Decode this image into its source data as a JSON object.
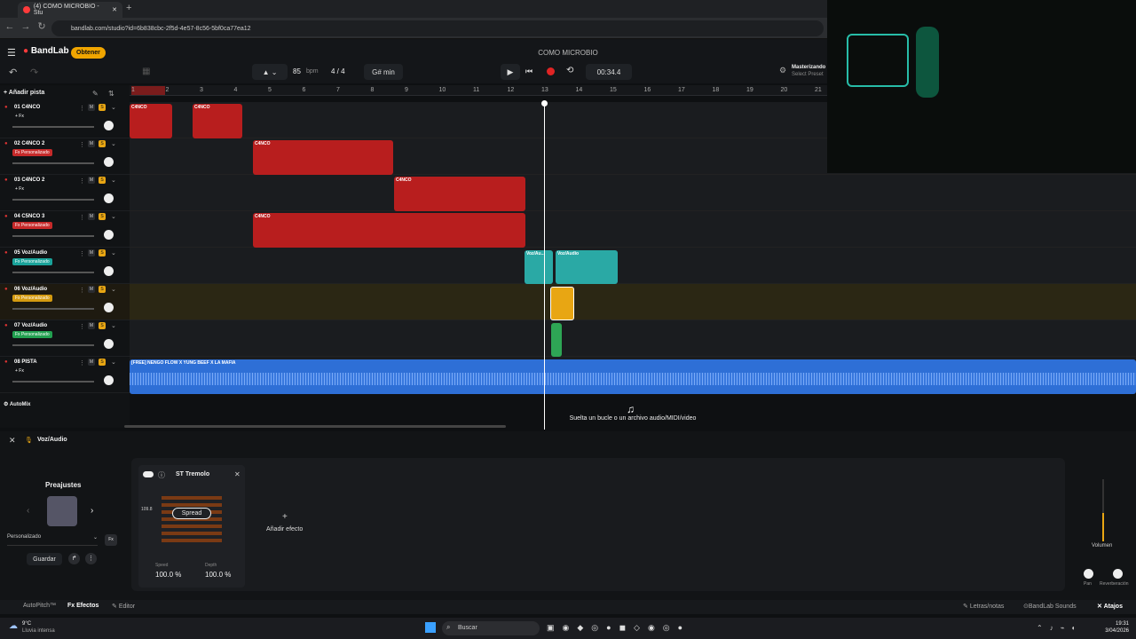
{
  "browser": {
    "tab_title": "(4) COMO MICROBIO - Stu",
    "url": "bandlab.com/studio?id=6b838cbc-2f5d-4e57-8c56-5bf0ca77ea12"
  },
  "app": {
    "logo": "BandLab",
    "get_label": "Obtener",
    "song_title": "COMO MICROBIO"
  },
  "toolbar": {
    "bpm": "85",
    "bpm_unit": "bpm",
    "time_sig": "4 / 4",
    "key": "G# min",
    "time": "00:34.4",
    "mastering_title": "Masterizando",
    "mastering_sub": "Select Preset"
  },
  "tracklist": {
    "add_track": "Añadir pista",
    "automix": "AutoMix"
  },
  "ruler": [
    "1",
    "2",
    "3",
    "4",
    "5",
    "6",
    "7",
    "8",
    "9",
    "10",
    "11",
    "12",
    "13",
    "14",
    "15",
    "16",
    "17",
    "18",
    "19",
    "20",
    "21"
  ],
  "tracks": [
    {
      "name": "01  C4NCO",
      "fx": "+ Fx",
      "fx_color": "none"
    },
    {
      "name": "02  C4NCO 2",
      "fx": "Fx Personalizado",
      "fx_color": "#c62a2a"
    },
    {
      "name": "03  C4NCO 2",
      "fx": "+ Fx",
      "fx_color": "none"
    },
    {
      "name": "04  C5NCO 3",
      "fx": "Fx Personalizado",
      "fx_color": "#c62a2a"
    },
    {
      "name": "05  Voz/Audio",
      "fx": "Fx Personalizado",
      "fx_color": "#1aa39a"
    },
    {
      "name": "06  Voz/Audio",
      "fx": "Fx Personalizado",
      "fx_color": "#d49a10"
    },
    {
      "name": "07  Voz/Audio",
      "fx": "Fx Personalizado",
      "fx_color": "#22a050"
    },
    {
      "name": "08  PISTA",
      "fx": "+ Fx",
      "fx_color": "none"
    }
  ],
  "mute_label": "M",
  "solo_label": "S",
  "clips": {
    "c1": "C4NCO",
    "c2": "C4NCO",
    "c3": "C4NCO",
    "c4": "C4NCO",
    "c5": "C4NCO",
    "v1": "Voz/Au...",
    "v2": "Voz/Audio",
    "pista": "[FREE] ÑENGO FLOW X YUNG BEEF X LA MAFIA"
  },
  "drop_hint": "Suelta un bucle o un archivo audio/MIDI/video",
  "panel": {
    "track_name": "Voz/Audio",
    "presets_title": "Preajustes",
    "preset_value": "Personalizado",
    "save": "Guardar",
    "effect_name": "ST Tremolo",
    "spread": "Spread",
    "scale_val": "109.8",
    "speed_label": "Speed",
    "speed_val": "100.0 %",
    "depth_label": "Depth",
    "depth_val": "100.0 %",
    "add_effect": "Añadir efecto",
    "volume": "Volumen",
    "pan": "Pan",
    "reverb": "Reverberación"
  },
  "status": {
    "autopitch": "AutoPitch™",
    "effects": "Efectos",
    "editor": "Editor",
    "lyrics": "Letras/notas",
    "sounds": "BandLab Sounds",
    "shortcuts": "Atajos"
  },
  "taskbar": {
    "weather_temp": "9°C",
    "weather_desc": "Lluvia intensa",
    "search": "Buscar",
    "time": "19:31",
    "date": "3/04/2026"
  }
}
